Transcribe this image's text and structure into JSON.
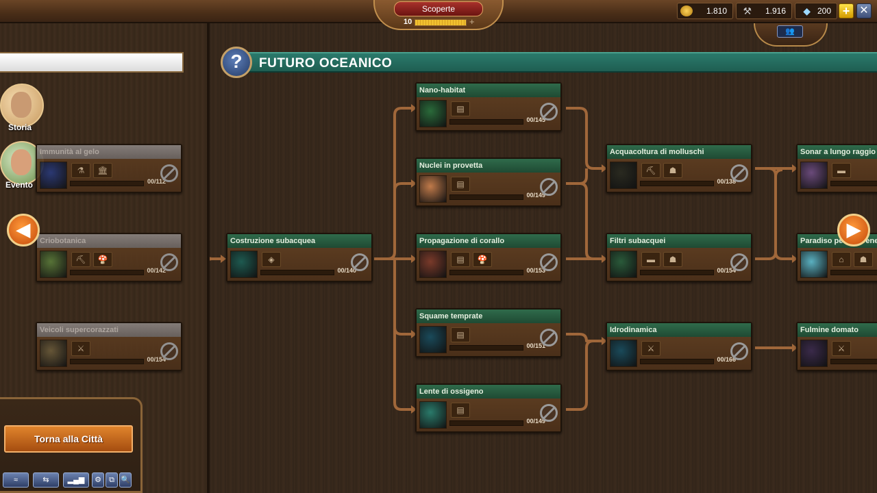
{
  "topbar": {
    "title": "Scoperte",
    "progress_level": "10",
    "progress_fraction": 1.0,
    "progress_plus": "+",
    "coins": "1.810",
    "supplies": "1.916",
    "gems": "200",
    "add_label": "+",
    "close_label": "✕",
    "chat_label": "👥"
  },
  "colors": {
    "accent": "#2a7a6c",
    "nav": "#e06a1a",
    "connector": "#a0673a"
  },
  "left_panel": {
    "search_placeholder": "",
    "story_label": "Storia",
    "event_label": "Evento",
    "back_button": "Torna alla Città",
    "tools": [
      "≈",
      "⇆",
      "▂▄▆",
      "⚙",
      "⧉",
      "🔍"
    ]
  },
  "era": {
    "title": "FUTURO OCEANICO",
    "help": "?"
  },
  "nav": {
    "prev": "◀",
    "next": "▶"
  },
  "cards": [
    {
      "id": "immunita",
      "title": "Immunità al gelo",
      "count": "00/112",
      "locked": true
    },
    {
      "id": "criobotanica",
      "title": "Criobotanica",
      "count": "00/142",
      "locked": true
    },
    {
      "id": "veicoli",
      "title": "Veicoli supercorazzati",
      "count": "00/154",
      "locked": true
    },
    {
      "id": "costruzione",
      "title": "Costruzione subacquea",
      "count": "00/140",
      "locked": false
    },
    {
      "id": "nano",
      "title": "Nano-habitat",
      "count": "00/145",
      "locked": false
    },
    {
      "id": "nuclei",
      "title": "Nuclei in provetta",
      "count": "00/149",
      "locked": false
    },
    {
      "id": "propagazione",
      "title": "Propagazione di corallo",
      "count": "00/153",
      "locked": false
    },
    {
      "id": "squame",
      "title": "Squame temprate",
      "count": "00/151",
      "locked": false
    },
    {
      "id": "lente",
      "title": "Lente di ossigeno",
      "count": "00/149",
      "locked": false
    },
    {
      "id": "acquacoltura",
      "title": "Acquacoltura di molluschi",
      "count": "00/138",
      "locked": false
    },
    {
      "id": "filtri",
      "title": "Filtri subacquei",
      "count": "00/154",
      "locked": false
    },
    {
      "id": "idrodinamica",
      "title": "Idrodinamica",
      "count": "00/166",
      "locked": false
    },
    {
      "id": "sonar",
      "title": "Sonar a lungo raggio",
      "count": "",
      "locked": false
    },
    {
      "id": "paradiso",
      "title": "Paradiso per le sirene",
      "count": "",
      "locked": false
    },
    {
      "id": "fulmine",
      "title": "Fulmine domato",
      "count": "",
      "locked": false
    }
  ]
}
